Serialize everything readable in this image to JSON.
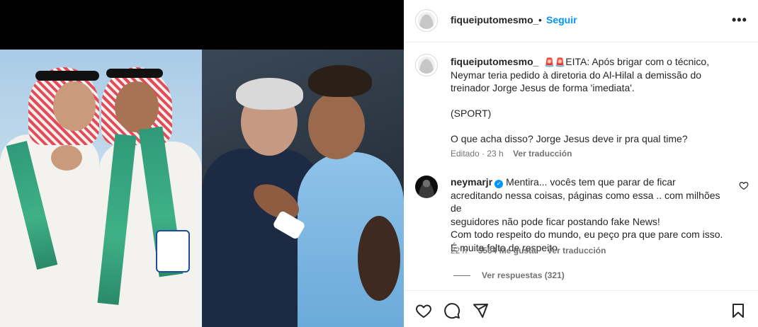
{
  "post": {
    "author": "fiqueiputomesmo_",
    "dot": "•",
    "follow_label": "Seguir",
    "more_label": "•••"
  },
  "caption": {
    "author": "fiqueiputomesmo_",
    "emoji": "🚨🚨",
    "line1": "EITA: Após brigar com o técnico,",
    "line2": "Neymar teria pedido à diretoria do Al-Hilal a demissão do",
    "line3": "treinador Jorge Jesus de forma 'imediata'.",
    "source": "(SPORT)",
    "question": "O que acha disso? Jorge Jesus deve ir pra qual time?",
    "edited": "Editado · 23 h",
    "see_translation": "Ver traducción"
  },
  "comment": {
    "author": "neymarjr",
    "verified_icon": "✓",
    "line1": "Mentira... vocês tem que parar de ficar",
    "line2": "acreditando nessa coisas, páginas como essa .. com milhões de",
    "line3": "seguidores não pode ficar postando fake News!",
    "line4": "Com todo respeito do mundo, eu peço pra que pare com isso.",
    "line5": "É muita falta de respeito",
    "time": "22 h",
    "likes": "5564 Me gusta",
    "see_translation": "Ver traducción",
    "view_replies": "Ver respuestas (321)"
  },
  "icons": {
    "header_avatar": "default-avatar-icon",
    "comment_like": "heart-outline-icon",
    "like": "heart-icon",
    "comment": "comment-bubble-icon",
    "share": "paper-plane-icon",
    "save": "bookmark-icon"
  },
  "colors": {
    "link_blue": "#0095f6",
    "text": "#262626",
    "muted": "#737373",
    "siren_red": "#e0302c"
  }
}
